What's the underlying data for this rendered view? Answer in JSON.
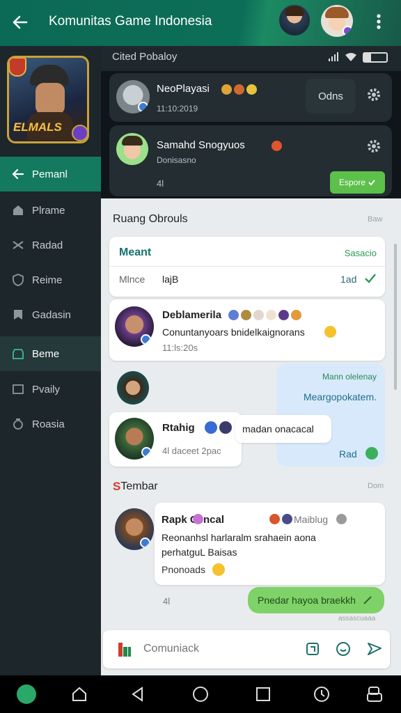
{
  "topbar": {
    "title": "Komunitas Game Indonesia",
    "back_icon": "back-arrow-icon",
    "more_icon": "more-vertical-icon"
  },
  "status": {
    "carrier": "Cited Pobaloy",
    "signal_icon": "signal-icon",
    "wifi_icon": "wifi-icon",
    "battery_icon": "battery-icon"
  },
  "cover": {
    "title": "ELMALS"
  },
  "sidebar": {
    "items": [
      {
        "label": "Pemanl",
        "icon": "back-arrow-icon"
      },
      {
        "label": "Plrame",
        "icon": "home-icon"
      },
      {
        "label": "Radad",
        "icon": "shuffle-icon"
      },
      {
        "label": "Reime",
        "icon": "shield-icon"
      },
      {
        "label": "Gadasin",
        "icon": "bookmark-icon"
      },
      {
        "label": "Beme",
        "icon": "store-icon"
      },
      {
        "label": "Pvaily",
        "icon": "image-icon"
      },
      {
        "label": "Roasia",
        "icon": "medal-icon"
      }
    ]
  },
  "dm1": {
    "name": "NeoPlayasi",
    "sub": "11:10:2019",
    "action": "Odns"
  },
  "dm2": {
    "name": "Samahd Snogyuos",
    "sub": "Donisasno",
    "count": "4l",
    "button": "Espore"
  },
  "room": {
    "title": "Ruang Obrouls",
    "meta": "Baw",
    "subcard": {
      "title": "Meant",
      "right": "Sasacio",
      "label": "Mlnce",
      "value": "lajB",
      "status": "1ad"
    },
    "msg1": {
      "name": "Deblamerila",
      "text": "Conuntanyoars bnidelkaignorans",
      "time": "11:ls:20s"
    },
    "blue_bubble": {
      "top": "Mann olelenay",
      "main": "Meargopokatem.",
      "foot": "Rad"
    },
    "msg2": {
      "name": "Rtahig",
      "text": "madan onacacal",
      "time": "4l daceet 2pac"
    }
  },
  "section2": {
    "title": "Tembar",
    "meta": "Dom",
    "post": {
      "name": "Rapk Cencal",
      "tag": "Maiblug",
      "text": "Reonanhsl harlaralm srahaein aona perhatguL Baisas",
      "reply": "Pnonoads",
      "count": "4l",
      "green": "Pnedar hayoa braekkh",
      "stamp": "assascuaaa"
    }
  },
  "input": {
    "placeholder": "Comuniack"
  },
  "colors": {
    "accent": "#0d6e58",
    "green_button": "#5cc04a",
    "active_nav": "#137a5f"
  }
}
